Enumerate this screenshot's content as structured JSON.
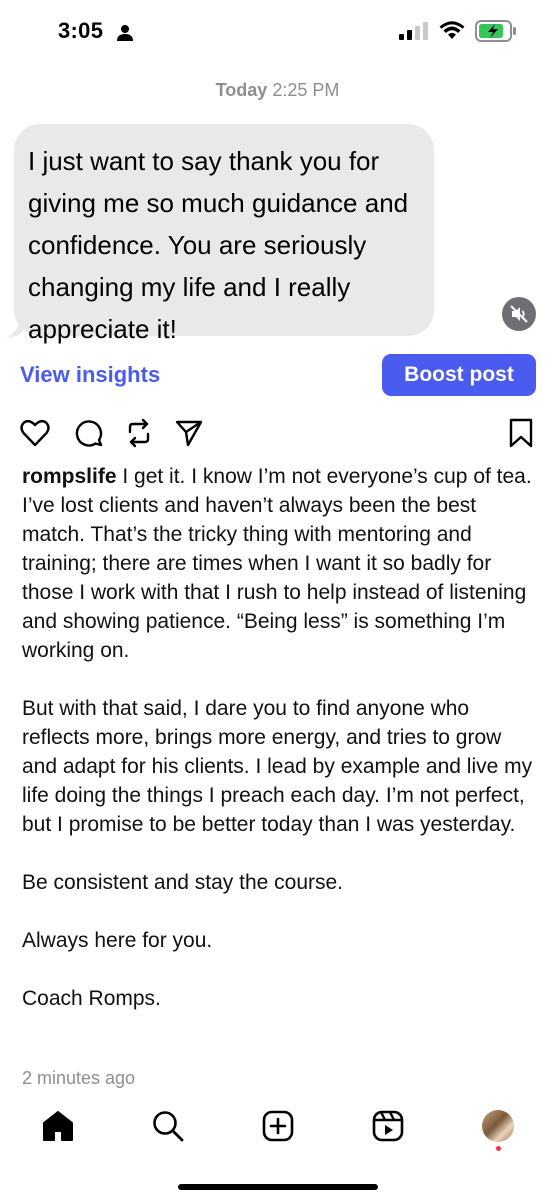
{
  "status_bar": {
    "time": "3:05"
  },
  "thread": {
    "timestamp_day": "Today",
    "timestamp_time": "2:25 PM",
    "message": "I just want to say thank you for giving me so much guidance and confidence. You are seriously changing my life and I really appreciate it!"
  },
  "post_actions": {
    "view_insights": "View insights",
    "boost_post": "Boost post"
  },
  "caption": {
    "username": "rompslife",
    "paragraph1": " I get it. I know I’m not everyone’s cup of tea. I’ve lost clients and haven’t always been the best match. That’s the tricky thing with mentoring and training; there are times when I want it so badly for those I work with that I rush to help instead of listening and showing patience. “Being less” is something I’m working on.",
    "paragraph2": "But with that said, I dare you to find anyone who reflects more, brings more energy, and tries to grow and adapt for his clients. I lead by example and live my life doing the things I preach each day. I’m not perfect, but I promise to be better today than I was yesterday.",
    "paragraph3": "Be consistent and stay the course.",
    "paragraph4": "Always here for you.",
    "paragraph5": "Coach Romps."
  },
  "post_time": "2 minutes ago",
  "icons": {
    "post": [
      "heart-icon",
      "comment-icon",
      "repost-icon",
      "share-icon",
      "bookmark-icon"
    ],
    "tabs": [
      "home-icon",
      "search-icon",
      "create-icon",
      "reels-icon",
      "profile-avatar"
    ]
  },
  "colors": {
    "accent": "#4a5cf0",
    "bubble": "#e9e9eb",
    "muted_text": "#8e8e93",
    "battery": "#34c759"
  }
}
